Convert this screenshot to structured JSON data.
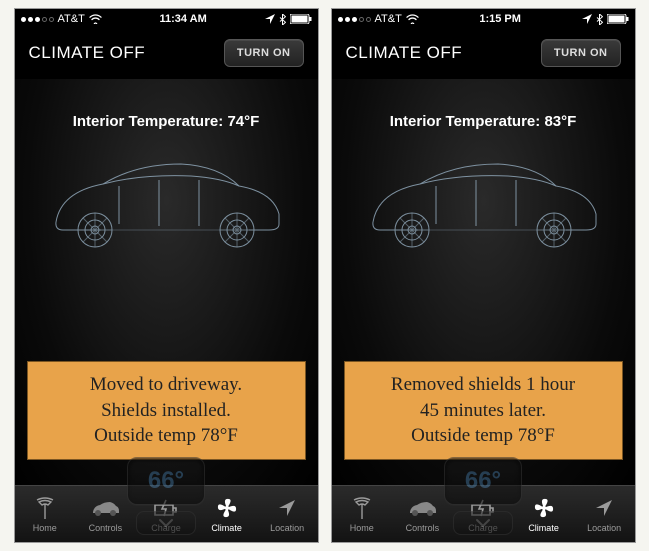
{
  "screens": [
    {
      "status": {
        "carrier": "AT&T",
        "time": "11:34 AM",
        "signal_filled": 3
      },
      "header": {
        "title": "CLIMATE OFF",
        "turn_on_label": "TURN ON"
      },
      "interior_temp_label": "Interior Temperature: 74°F",
      "annotation": {
        "line1": "Moved to driveway.",
        "line2": "Shields installed.",
        "line3": "Outside temp 78°F"
      },
      "dial_value": "66°"
    },
    {
      "status": {
        "carrier": "AT&T",
        "time": "1:15 PM",
        "signal_filled": 3
      },
      "header": {
        "title": "CLIMATE OFF",
        "turn_on_label": "TURN ON"
      },
      "interior_temp_label": "Interior Temperature: 83°F",
      "annotation": {
        "line1": "Removed shields 1 hour",
        "line2": "45 minutes later.",
        "line3": "Outside temp 78°F"
      },
      "dial_value": "66°"
    }
  ],
  "tabs": [
    {
      "label": "Home",
      "icon": "tesla-logo-icon"
    },
    {
      "label": "Controls",
      "icon": "car-icon"
    },
    {
      "label": "Charge",
      "icon": "battery-bolt-icon"
    },
    {
      "label": "Climate",
      "icon": "fan-icon"
    },
    {
      "label": "Location",
      "icon": "location-arrow-icon"
    }
  ],
  "active_tab_index": 3
}
